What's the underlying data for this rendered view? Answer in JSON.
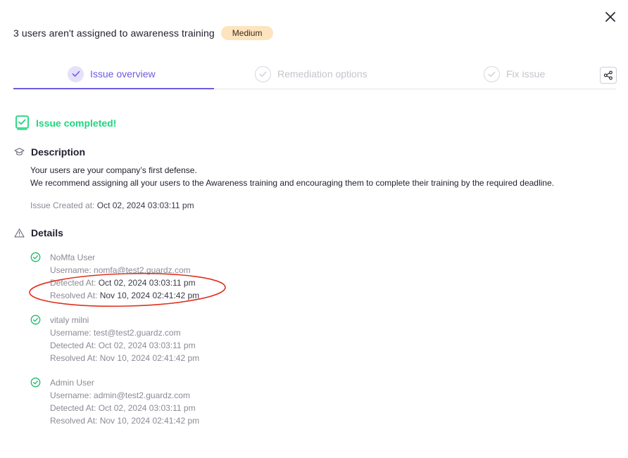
{
  "header": {
    "title": "3 users aren't assigned to awareness training",
    "severity": "Medium"
  },
  "tabs": [
    {
      "label": "Issue overview",
      "state": "active"
    },
    {
      "label": "Remediation options",
      "state": "inactive"
    },
    {
      "label": "Fix issue",
      "state": "inactive"
    }
  ],
  "status": {
    "text": "Issue completed!"
  },
  "description": {
    "heading": "Description",
    "lines": [
      "Your users are your company’s first defense.",
      "We recommend assigning all your users to the Awareness training and encouraging them to complete their training by the required deadline."
    ],
    "created_label": "Issue Created at:",
    "created_value": "Oct 02, 2024 03:03:11 pm"
  },
  "details": {
    "heading": "Details",
    "labels": {
      "username": "Username:",
      "detected": "Detected At:",
      "resolved": "Resolved At:"
    },
    "users": [
      {
        "name": "NoMfa User",
        "username": "nomfa@test2.guardz.com",
        "detected": "Oct 02, 2024 03:03:11 pm",
        "resolved": "Nov 10, 2024 02:41:42 pm"
      },
      {
        "name": "vitaly milni",
        "username": "test@test2.guardz.com",
        "detected": "Oct 02, 2024 03:03:11 pm",
        "resolved": "Nov 10, 2024 02:41:42 pm"
      },
      {
        "name": "Admin User",
        "username": "admin@test2.guardz.com",
        "detected": "Oct 02, 2024 03:03:11 pm",
        "resolved": "Nov 10, 2024 02:41:42 pm"
      }
    ]
  },
  "icons": {
    "close": "close-icon",
    "share": "share-icon",
    "tab_check": "check-circle-icon",
    "status": "checkbox-checked-icon",
    "description": "graduation-cap-icon",
    "details": "warning-triangle-icon",
    "user_check": "check-circle-icon"
  },
  "colors": {
    "accent": "#6b5be0",
    "success": "#1fd67d",
    "badge_bg": "#fde4bf",
    "annotation": "#e0301e"
  }
}
